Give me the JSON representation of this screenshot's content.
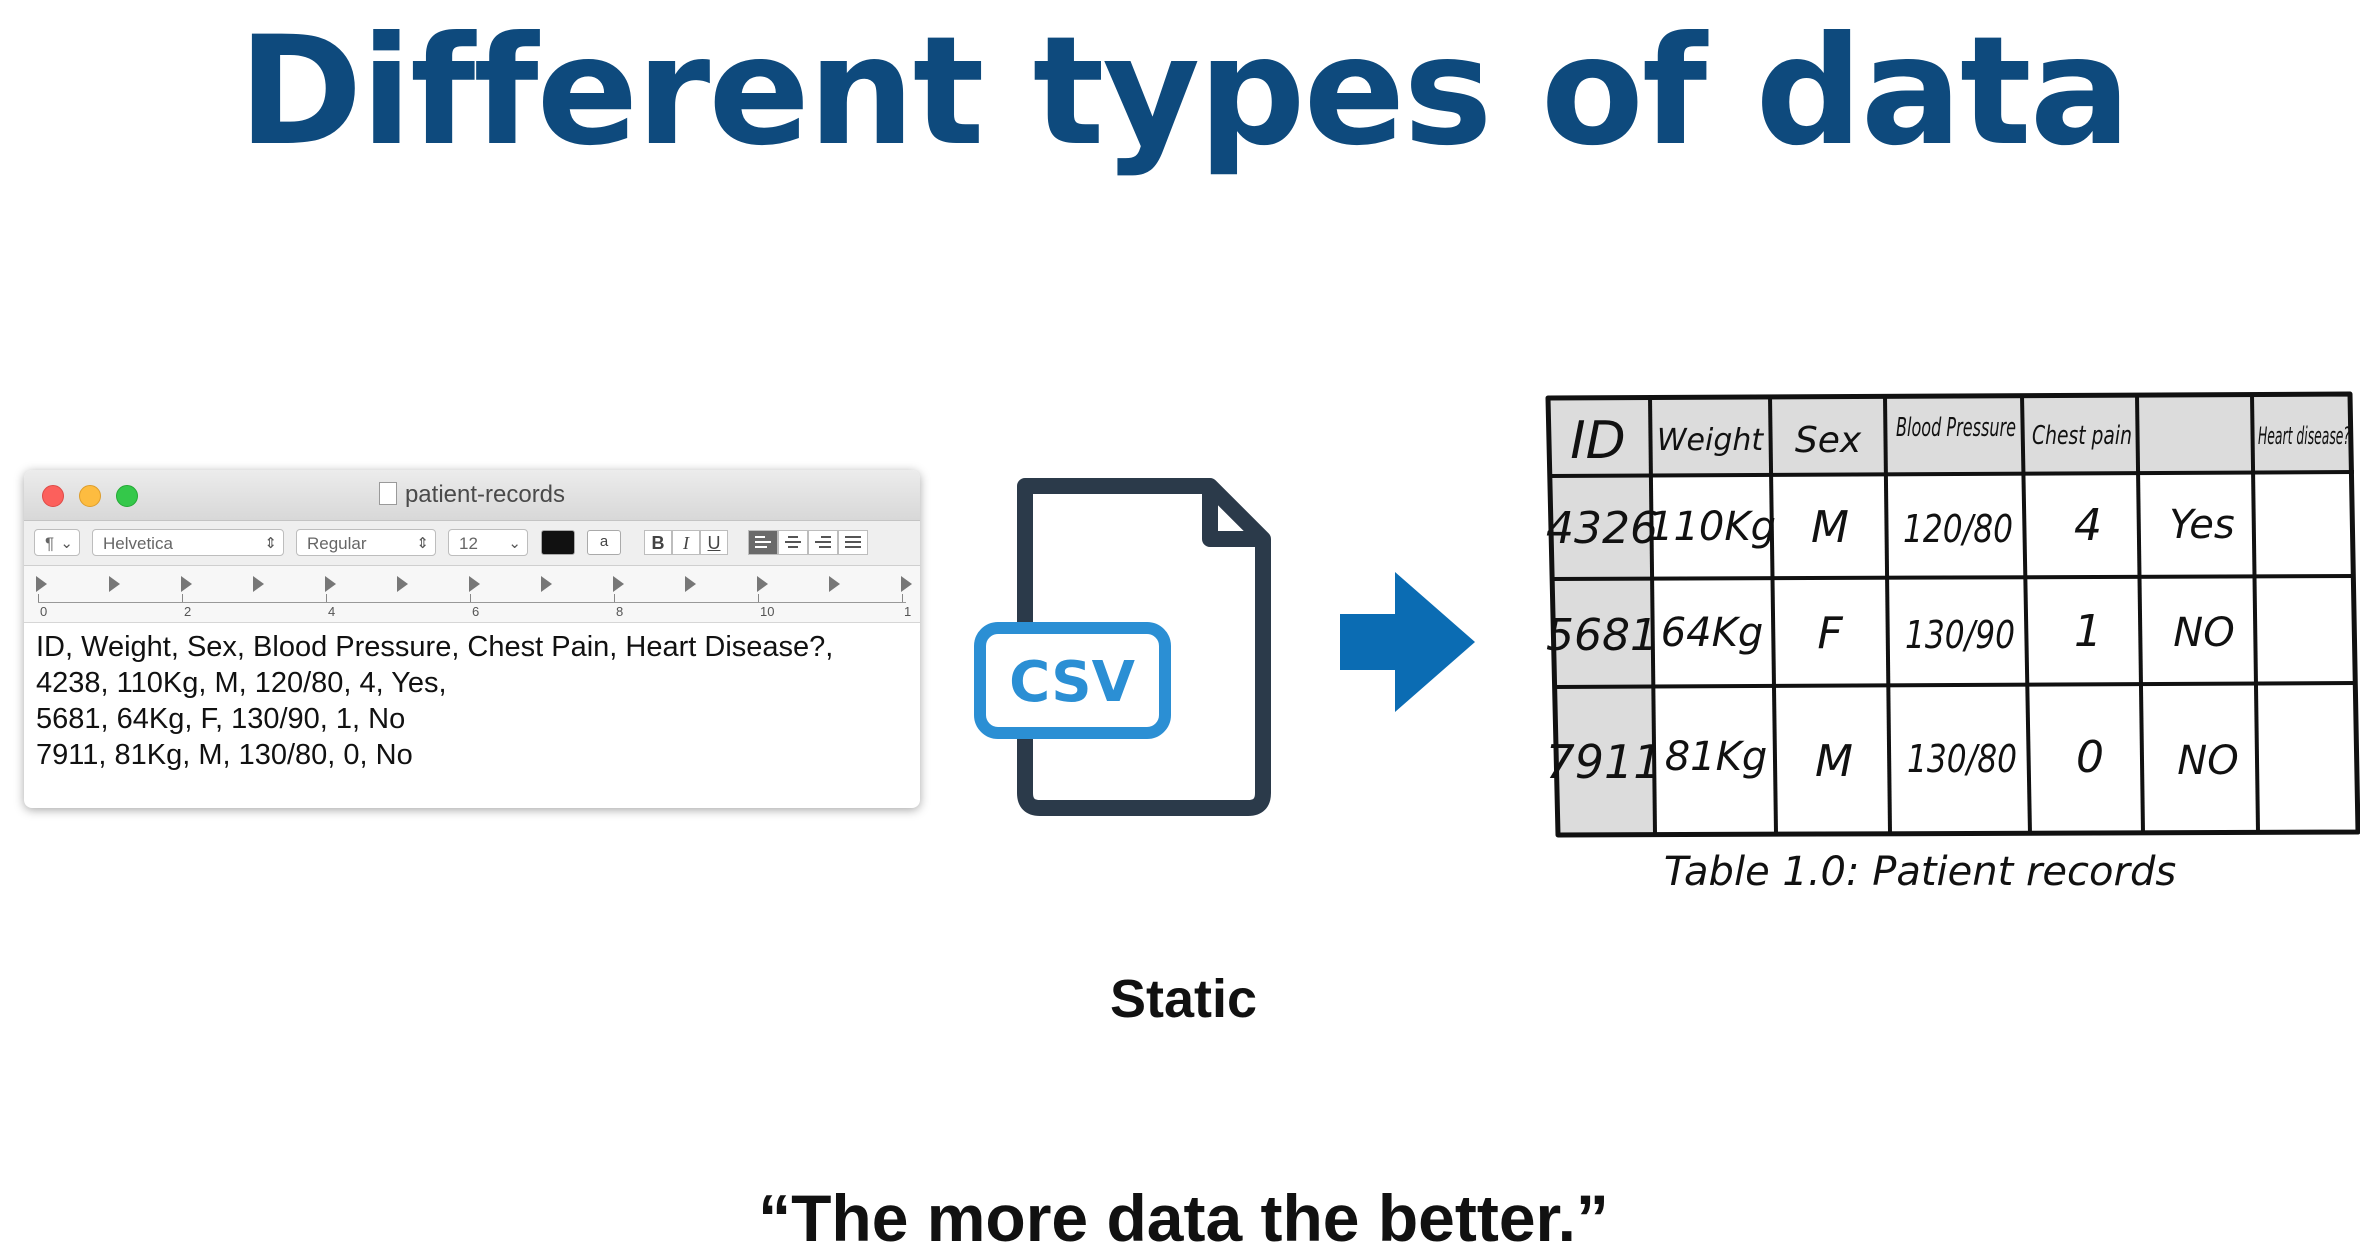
{
  "title": "Different types of data",
  "textedit": {
    "window_title": "patient-records",
    "toolbar": {
      "paragraph_symbol": "¶",
      "font_family": "Helvetica",
      "font_style": "Regular",
      "font_size": "12",
      "bold": "B",
      "italic": "I",
      "underline": "U",
      "text_color_swatch": "a"
    },
    "ruler_labels": [
      "0",
      "2",
      "4",
      "6",
      "8",
      "10",
      "1"
    ],
    "lines": [
      "ID, Weight, Sex, Blood Pressure, Chest Pain, Heart Disease?,",
      "4238, 110Kg, M, 120/80, 4, Yes,",
      "5681, 64Kg, F, 130/90, 1, No",
      "7911, 81Kg, M, 130/80, 0, No"
    ]
  },
  "csv_icon": {
    "label": "CSV",
    "icon": "file-icon"
  },
  "arrow": {
    "icon": "arrow-right-icon",
    "color": "#0b6cb3"
  },
  "hand_table": {
    "headers": [
      "ID",
      "Weight",
      "Sex",
      "Blood Pressure",
      "Chest pain",
      "Heart disease?"
    ],
    "rows": [
      [
        "4326",
        "110Kg",
        "M",
        "120/80",
        "4",
        "Yes"
      ],
      [
        "5681",
        "64Kg",
        "F",
        "130/90",
        "1",
        "NO"
      ],
      [
        "7911",
        "81Kg",
        "M",
        "130/80",
        "0",
        "NO"
      ]
    ],
    "caption": "Table 1.0: Patient records"
  },
  "static_label": "Static",
  "quote": "“The more data the better.”",
  "colors": {
    "title": "#0e4a7d",
    "csv_blue": "#2b8fd4",
    "icon_dark": "#2b3a4a"
  }
}
